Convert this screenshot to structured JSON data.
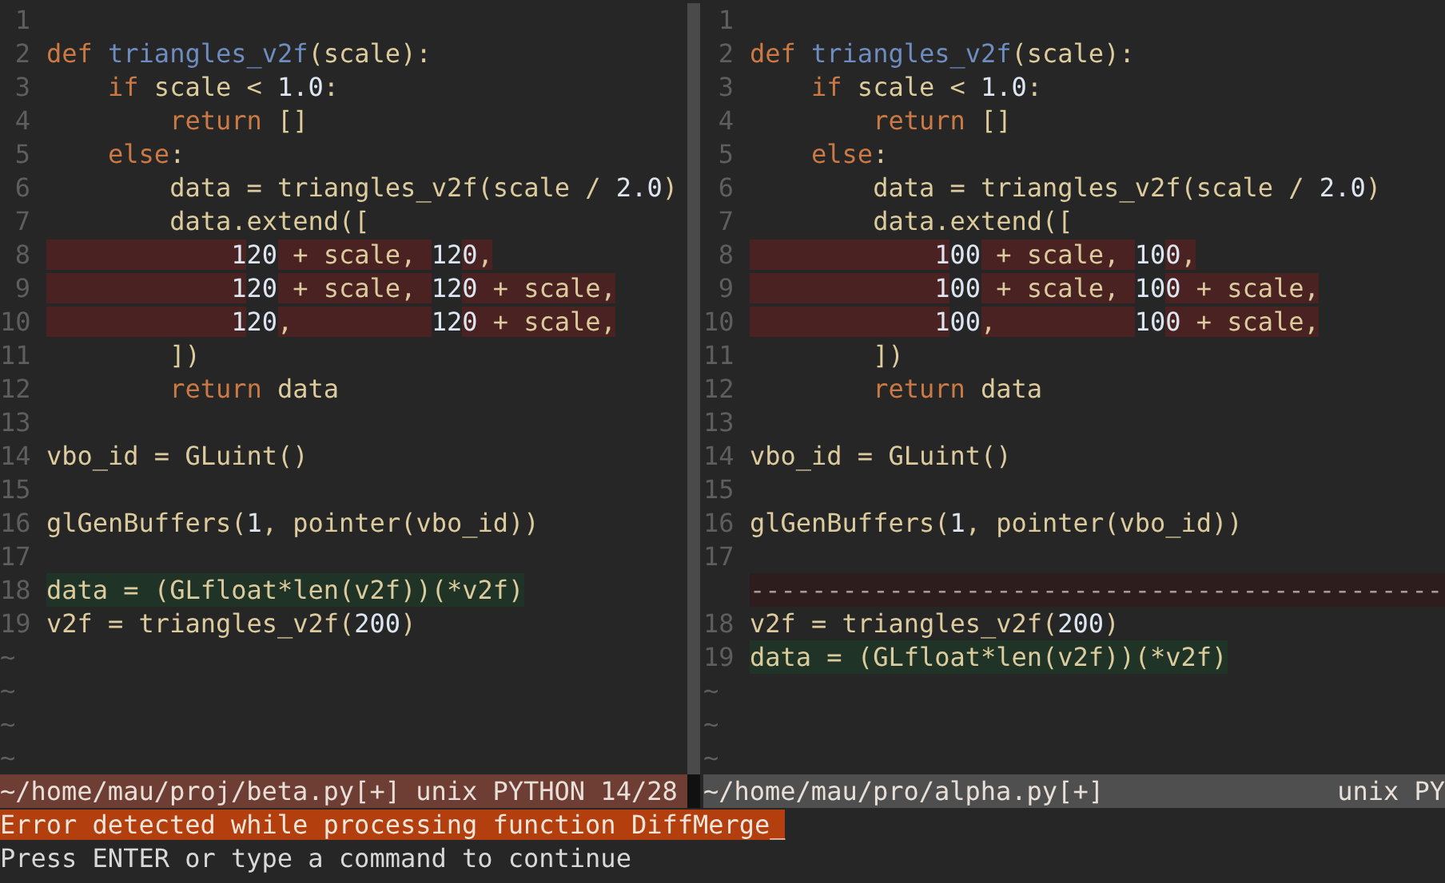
{
  "windows": [
    {
      "active": true,
      "lines": [
        {
          "number": "1",
          "kind": "normal"
        },
        {
          "number": "2",
          "kind": "normal",
          "segments": [
            {
              "text": "def ",
              "kind": "keyword"
            },
            {
              "text": "triangles_v2f",
              "kind": "function"
            },
            {
              "text": "(scale):"
            }
          ]
        },
        {
          "number": "3",
          "kind": "normal",
          "segments": [
            {
              "text": "    if",
              "kind": "keyword"
            },
            {
              "text": " scale < "
            },
            {
              "text": "1.0",
              "kind": "number"
            },
            {
              "text": ":"
            }
          ]
        },
        {
          "number": "4",
          "kind": "normal",
          "segments": [
            {
              "text": "        return",
              "kind": "keyword"
            },
            {
              "text": " []"
            }
          ]
        },
        {
          "number": "5",
          "kind": "normal",
          "segments": [
            {
              "text": "    else",
              "kind": "keyword"
            },
            {
              "text": ":"
            }
          ]
        },
        {
          "number": "6",
          "kind": "normal",
          "segments": [
            {
              "text": "        data = triangles_v2f(scale / "
            },
            {
              "text": "2.0",
              "kind": "number"
            },
            {
              "text": ")"
            }
          ]
        },
        {
          "number": "7",
          "kind": "normal",
          "segments": [
            {
              "text": "        data.extend(["
            }
          ]
        },
        {
          "number": "8",
          "kind": "changed",
          "segments": [
            {
              "text": "            1",
              "kind": "number",
              "highlight": true
            },
            {
              "text": "20",
              "kind": "number",
              "highlight": false
            },
            {
              "text": " + scale, ",
              "highlight": true
            },
            {
              "text": "12",
              "kind": "number",
              "highlight": false
            },
            {
              "text": "0",
              "kind": "number",
              "highlight": true
            },
            {
              "text": ",",
              "highlight": true
            }
          ]
        },
        {
          "number": "9",
          "kind": "changed",
          "segments": [
            {
              "text": "            1",
              "kind": "number",
              "highlight": true
            },
            {
              "text": "20",
              "kind": "number",
              "highlight": false
            },
            {
              "text": " + scale, ",
              "highlight": true
            },
            {
              "text": "12",
              "kind": "number",
              "highlight": false
            },
            {
              "text": "0",
              "kind": "number",
              "highlight": true
            },
            {
              "text": " + scale,",
              "highlight": true
            }
          ]
        },
        {
          "number": "10",
          "kind": "changed",
          "segments": [
            {
              "text": "            1",
              "kind": "number",
              "highlight": true
            },
            {
              "text": "20",
              "kind": "number",
              "highlight": false
            },
            {
              "text": ",         ",
              "highlight": true
            },
            {
              "text": "12",
              "kind": "number",
              "highlight": false
            },
            {
              "text": "0",
              "kind": "number",
              "highlight": true
            },
            {
              "text": " + scale,",
              "highlight": true
            }
          ]
        },
        {
          "number": "11",
          "kind": "normal",
          "segments": [
            {
              "text": "        ])"
            }
          ]
        },
        {
          "number": "12",
          "kind": "normal",
          "segments": [
            {
              "text": "        return",
              "kind": "keyword"
            },
            {
              "text": " data"
            }
          ]
        },
        {
          "number": "13",
          "kind": "normal"
        },
        {
          "number": "14",
          "kind": "normal",
          "segments": [
            {
              "text": "vbo_id = GLuint()"
            }
          ]
        },
        {
          "number": "15",
          "kind": "normal"
        },
        {
          "number": "16",
          "kind": "normal",
          "segments": [
            {
              "text": "glGenBuffers("
            },
            {
              "text": "1",
              "kind": "number"
            },
            {
              "text": ", pointer(vbo_id))"
            }
          ]
        },
        {
          "number": "17",
          "kind": "normal"
        },
        {
          "number": "18",
          "kind": "added",
          "segments": [
            {
              "text": "data = (GLfloat*len(v2f))(*v2f)"
            }
          ]
        },
        {
          "number": "19",
          "kind": "normal",
          "segments": [
            {
              "text": "v2f = triangles_v2f("
            },
            {
              "text": "200",
              "kind": "number"
            },
            {
              "text": ")"
            }
          ]
        },
        {
          "kind": "empty",
          "text": "~"
        },
        {
          "kind": "empty",
          "text": "~"
        },
        {
          "kind": "empty",
          "text": "~"
        },
        {
          "kind": "empty",
          "text": "~"
        }
      ],
      "status_bar": {
        "left": "~/home/mau/proj/beta.py[+] unix PYTHON 14/28"
      }
    },
    {
      "active": false,
      "lines": [
        {
          "number": "1",
          "kind": "normal"
        },
        {
          "number": "2",
          "kind": "normal",
          "segments": [
            {
              "text": "def ",
              "kind": "keyword"
            },
            {
              "text": "triangles_v2f",
              "kind": "function"
            },
            {
              "text": "(scale):"
            }
          ]
        },
        {
          "number": "3",
          "kind": "normal",
          "segments": [
            {
              "text": "    if",
              "kind": "keyword"
            },
            {
              "text": " scale < "
            },
            {
              "text": "1.0",
              "kind": "number"
            },
            {
              "text": ":"
            }
          ]
        },
        {
          "number": "4",
          "kind": "normal",
          "segments": [
            {
              "text": "        return",
              "kind": "keyword"
            },
            {
              "text": " []"
            }
          ]
        },
        {
          "number": "5",
          "kind": "normal",
          "segments": [
            {
              "text": "    else",
              "kind": "keyword"
            },
            {
              "text": ":"
            }
          ]
        },
        {
          "number": "6",
          "kind": "normal",
          "segments": [
            {
              "text": "        data = triangles_v2f(scale / "
            },
            {
              "text": "2.0",
              "kind": "number"
            },
            {
              "text": ")"
            }
          ]
        },
        {
          "number": "7",
          "kind": "normal",
          "segments": [
            {
              "text": "        data.extend(["
            }
          ]
        },
        {
          "number": "8",
          "kind": "changed",
          "segments": [
            {
              "text": "            1",
              "kind": "number",
              "highlight": true
            },
            {
              "text": "00",
              "kind": "number",
              "highlight": false
            },
            {
              "text": " + scale, ",
              "highlight": true
            },
            {
              "text": "10",
              "kind": "number",
              "highlight": false
            },
            {
              "text": "0",
              "kind": "number",
              "highlight": true
            },
            {
              "text": ",",
              "highlight": true
            }
          ]
        },
        {
          "number": "9",
          "kind": "changed",
          "segments": [
            {
              "text": "            1",
              "kind": "number",
              "highlight": true
            },
            {
              "text": "00",
              "kind": "number",
              "highlight": false
            },
            {
              "text": " + scale, ",
              "highlight": true
            },
            {
              "text": "10",
              "kind": "number",
              "highlight": false
            },
            {
              "text": "0",
              "kind": "number",
              "highlight": true
            },
            {
              "text": " + scale,",
              "highlight": true
            }
          ]
        },
        {
          "number": "10",
          "kind": "changed",
          "segments": [
            {
              "text": "            1",
              "kind": "number",
              "highlight": true
            },
            {
              "text": "00",
              "kind": "number",
              "highlight": false
            },
            {
              "text": ",         ",
              "highlight": true
            },
            {
              "text": "10",
              "kind": "number",
              "highlight": false
            },
            {
              "text": "0",
              "kind": "number",
              "highlight": true
            },
            {
              "text": " + scale,",
              "highlight": true
            }
          ]
        },
        {
          "number": "11",
          "kind": "normal",
          "segments": [
            {
              "text": "        ])"
            }
          ]
        },
        {
          "number": "12",
          "kind": "normal",
          "segments": [
            {
              "text": "        return",
              "kind": "keyword"
            },
            {
              "text": " data"
            }
          ]
        },
        {
          "number": "13",
          "kind": "normal"
        },
        {
          "number": "14",
          "kind": "normal",
          "segments": [
            {
              "text": "vbo_id = GLuint()"
            }
          ]
        },
        {
          "number": "15",
          "kind": "normal"
        },
        {
          "number": "16",
          "kind": "normal",
          "segments": [
            {
              "text": "glGenBuffers("
            },
            {
              "text": "1",
              "kind": "number"
            },
            {
              "text": ", pointer(vbo_id))"
            }
          ]
        },
        {
          "number": "17",
          "kind": "normal"
        },
        {
          "kind": "filler",
          "text": "---------------------------------------------"
        },
        {
          "number": "18",
          "kind": "normal",
          "segments": [
            {
              "text": "v2f = triangles_v2f("
            },
            {
              "text": "200",
              "kind": "number"
            },
            {
              "text": ")"
            }
          ]
        },
        {
          "number": "19",
          "kind": "added",
          "segments": [
            {
              "text": "data = (GLfloat*len(v2f))(*v2f)"
            }
          ]
        },
        {
          "kind": "empty",
          "text": "~"
        },
        {
          "kind": "empty",
          "text": "~"
        },
        {
          "kind": "empty",
          "text": "~"
        }
      ],
      "status_bar": {
        "left": "~/home/mau/pro/alpha.py[+]",
        "right": "unix PY"
      }
    }
  ],
  "messages": [
    {
      "kind": "error",
      "text": "Error detected while processing function DiffMerge_"
    },
    {
      "kind": "prompt",
      "text": "Press ENTER or type a command to continue"
    }
  ]
}
